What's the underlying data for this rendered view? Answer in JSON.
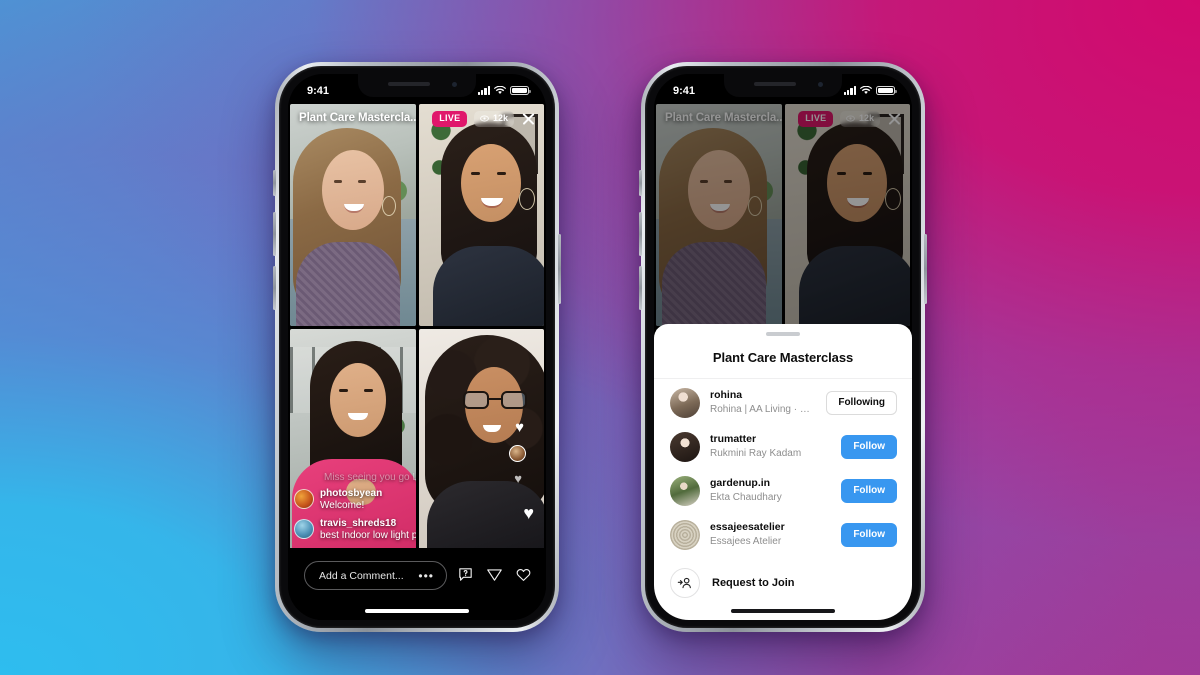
{
  "background": {
    "gradient_from": "#4e93d4",
    "gradient_mid": "#7a6ab5",
    "gradient_to": "#d2096d",
    "accent_blue": "#2ebdef",
    "accent_magenta": "#c8106f"
  },
  "phones": {
    "left": {
      "status_bar": {
        "time": "9:41",
        "wifi": "wifi-icon",
        "battery": "battery-icon",
        "signal": "cellular-signal-icon"
      },
      "live": {
        "title": "Plant Care Mastercla...",
        "live_badge": "LIVE",
        "viewer_count": "12k",
        "viewer_icon": "eye-icon",
        "close_icon": "close-icon",
        "tiles": [
          {
            "id": "tile-1",
            "label": "host-video"
          },
          {
            "id": "tile-2",
            "label": "guest-video-1"
          },
          {
            "id": "tile-3",
            "label": "guest-video-2"
          },
          {
            "id": "tile-4",
            "label": "guest-video-3"
          }
        ]
      },
      "comments": {
        "faded": "Miss seeing you go Live!",
        "items": [
          {
            "user": "photosbyean",
            "message": "Welcome!"
          },
          {
            "user": "travis_shreds18",
            "message": "best Indoor low light plan to maintain?"
          }
        ]
      },
      "comment_bar": {
        "placeholder": "Add a Comment...",
        "more_icon": "ellipsis-icon",
        "question_icon": "question-bubble-icon",
        "share_icon": "paper-plane-icon",
        "like_icon": "heart-icon"
      }
    },
    "right": {
      "status_bar": {
        "time": "9:41",
        "wifi": "wifi-icon",
        "battery": "battery-icon",
        "signal": "cellular-signal-icon"
      },
      "live": {
        "title": "Plant Care Mastercla...",
        "live_badge": "LIVE",
        "viewer_count": "12k",
        "viewer_icon": "eye-icon",
        "close_icon": "close-icon"
      },
      "sheet": {
        "grabber": "sheet-grabber",
        "title": "Plant Care Masterclass",
        "users": [
          {
            "username": "rohina",
            "subtitle": "Rohina | AA Living · Host",
            "action": "Following",
            "action_state": "following",
            "avatar": "avatar-rohina"
          },
          {
            "username": "trumatter",
            "subtitle": "Rukmini Ray Kadam",
            "action": "Follow",
            "action_state": "follow",
            "avatar": "avatar-trumatter"
          },
          {
            "username": "gardenup.in",
            "subtitle": "Ekta Chaudhary",
            "action": "Follow",
            "action_state": "follow",
            "avatar": "avatar-gardenup"
          },
          {
            "username": "essajeesatelier",
            "subtitle": "Essajees Atelier",
            "action": "Follow",
            "action_state": "follow",
            "avatar": "avatar-essajees"
          }
        ],
        "request": {
          "icon": "add-person-icon",
          "label": "Request to Join"
        }
      }
    }
  }
}
